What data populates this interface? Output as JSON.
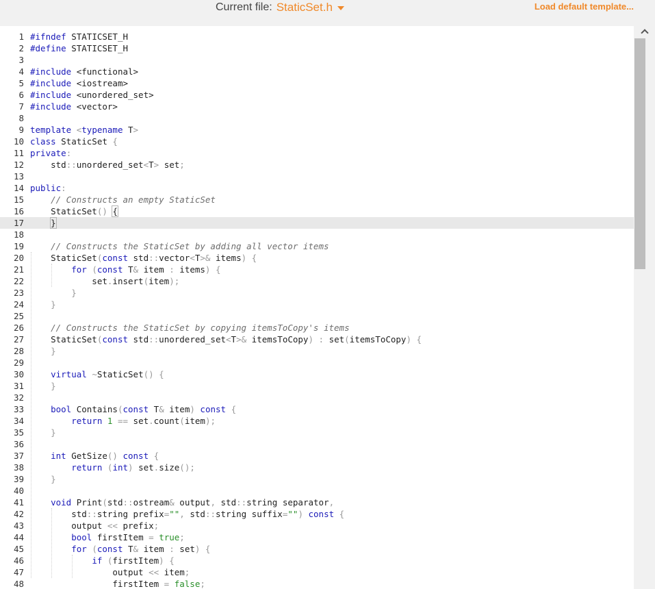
{
  "header": {
    "file_label": "Current file:",
    "file_name": "StaticSet.h",
    "load_template": "Load default template..."
  },
  "editor": {
    "active_line": 17,
    "lines": [
      {
        "n": "1",
        "tokens": [
          [
            "pp",
            "#ifndef "
          ],
          [
            "",
            "STATICSET_H"
          ]
        ]
      },
      {
        "n": "2",
        "tokens": [
          [
            "pp",
            "#define "
          ],
          [
            "",
            "STATICSET_H"
          ]
        ]
      },
      {
        "n": "3",
        "tokens": []
      },
      {
        "n": "4",
        "tokens": [
          [
            "pp",
            "#include "
          ],
          [
            "",
            "<functional>"
          ]
        ]
      },
      {
        "n": "5",
        "tokens": [
          [
            "pp",
            "#include "
          ],
          [
            "",
            "<iostream>"
          ]
        ]
      },
      {
        "n": "6",
        "tokens": [
          [
            "pp",
            "#include "
          ],
          [
            "",
            "<unordered_set>"
          ]
        ]
      },
      {
        "n": "7",
        "tokens": [
          [
            "pp",
            "#include "
          ],
          [
            "",
            "<vector>"
          ]
        ]
      },
      {
        "n": "8",
        "tokens": []
      },
      {
        "n": "9",
        "tokens": [
          [
            "kw",
            "template "
          ],
          [
            "pu",
            "<"
          ],
          [
            "kw",
            "typename "
          ],
          [
            "",
            "T"
          ],
          [
            "pu",
            ">"
          ]
        ]
      },
      {
        "n": "10",
        "tokens": [
          [
            "kw",
            "class "
          ],
          [
            "",
            "StaticSet "
          ],
          [
            "pu",
            "{"
          ]
        ]
      },
      {
        "n": "11",
        "tokens": [
          [
            "kw",
            "private"
          ],
          [
            "pu",
            ":"
          ]
        ]
      },
      {
        "n": "12",
        "tokens": [
          [
            "",
            "    std"
          ],
          [
            "pu",
            "::"
          ],
          [
            "",
            "unordered_set"
          ],
          [
            "pu",
            "<"
          ],
          [
            "",
            "T"
          ],
          [
            "pu",
            ">"
          ],
          [
            "",
            " set"
          ],
          [
            "pu",
            ";"
          ]
        ]
      },
      {
        "n": "13",
        "tokens": []
      },
      {
        "n": "14",
        "tokens": [
          [
            "kw",
            "public"
          ],
          [
            "pu",
            ":"
          ]
        ]
      },
      {
        "n": "15",
        "tokens": [
          [
            "",
            "    "
          ],
          [
            "cm",
            "// Constructs an empty StaticSet"
          ]
        ]
      },
      {
        "n": "16",
        "tokens": [
          [
            "",
            "    StaticSet"
          ],
          [
            "pu",
            "() "
          ],
          [
            "brk",
            "{"
          ]
        ]
      },
      {
        "n": "17",
        "tokens": [
          [
            "",
            "    "
          ],
          [
            "brk",
            "}"
          ],
          [
            "cursor",
            ""
          ]
        ]
      },
      {
        "n": "18",
        "tokens": []
      },
      {
        "n": "19",
        "tokens": [
          [
            "",
            "    "
          ],
          [
            "cm",
            "// Constructs the StaticSet by adding all vector items"
          ]
        ]
      },
      {
        "n": "20",
        "tokens": [
          [
            "",
            "    StaticSet"
          ],
          [
            "pu",
            "("
          ],
          [
            "kw",
            "const "
          ],
          [
            "",
            "std"
          ],
          [
            "pu",
            "::"
          ],
          [
            "",
            "vector"
          ],
          [
            "pu",
            "<"
          ],
          [
            "",
            "T"
          ],
          [
            "pu",
            ">&"
          ],
          [
            "",
            " items"
          ],
          [
            "pu",
            ") {"
          ]
        ]
      },
      {
        "n": "21",
        "tokens": [
          [
            "",
            "        "
          ],
          [
            "kw",
            "for "
          ],
          [
            "pu",
            "("
          ],
          [
            "kw",
            "const "
          ],
          [
            "",
            "T"
          ],
          [
            "pu",
            "&"
          ],
          [
            "",
            " item "
          ],
          [
            "pu",
            ":"
          ],
          [
            "",
            " items"
          ],
          [
            "pu",
            ") {"
          ]
        ]
      },
      {
        "n": "22",
        "tokens": [
          [
            "",
            "            set"
          ],
          [
            "pu",
            "."
          ],
          [
            "",
            "insert"
          ],
          [
            "pu",
            "("
          ],
          [
            "",
            "item"
          ],
          [
            "pu",
            ");"
          ]
        ]
      },
      {
        "n": "23",
        "tokens": [
          [
            "",
            "        "
          ],
          [
            "pu",
            "}"
          ]
        ]
      },
      {
        "n": "24",
        "tokens": [
          [
            "",
            "    "
          ],
          [
            "pu",
            "}"
          ]
        ]
      },
      {
        "n": "25",
        "tokens": []
      },
      {
        "n": "26",
        "tokens": [
          [
            "",
            "    "
          ],
          [
            "cm",
            "// Constructs the StaticSet by copying itemsToCopy's items"
          ]
        ]
      },
      {
        "n": "27",
        "tokens": [
          [
            "",
            "    StaticSet"
          ],
          [
            "pu",
            "("
          ],
          [
            "kw",
            "const "
          ],
          [
            "",
            "std"
          ],
          [
            "pu",
            "::"
          ],
          [
            "",
            "unordered_set"
          ],
          [
            "pu",
            "<"
          ],
          [
            "",
            "T"
          ],
          [
            "pu",
            ">&"
          ],
          [
            "",
            " itemsToCopy"
          ],
          [
            "pu",
            ") : "
          ],
          [
            "",
            "set"
          ],
          [
            "pu",
            "("
          ],
          [
            "",
            "itemsToCopy"
          ],
          [
            "pu",
            ") {"
          ]
        ]
      },
      {
        "n": "28",
        "tokens": [
          [
            "",
            "    "
          ],
          [
            "pu",
            "}"
          ]
        ]
      },
      {
        "n": "29",
        "tokens": []
      },
      {
        "n": "30",
        "tokens": [
          [
            "",
            "    "
          ],
          [
            "kw",
            "virtual "
          ],
          [
            "pu",
            "~"
          ],
          [
            "",
            "StaticSet"
          ],
          [
            "pu",
            "() {"
          ]
        ]
      },
      {
        "n": "31",
        "tokens": [
          [
            "",
            "    "
          ],
          [
            "pu",
            "}"
          ]
        ]
      },
      {
        "n": "32",
        "tokens": []
      },
      {
        "n": "33",
        "tokens": [
          [
            "",
            "    "
          ],
          [
            "kw",
            "bool "
          ],
          [
            "",
            "Contains"
          ],
          [
            "pu",
            "("
          ],
          [
            "kw",
            "const "
          ],
          [
            "",
            "T"
          ],
          [
            "pu",
            "&"
          ],
          [
            "",
            " item"
          ],
          [
            "pu",
            ") "
          ],
          [
            "kw",
            "const "
          ],
          [
            "pu",
            "{"
          ]
        ]
      },
      {
        "n": "34",
        "tokens": [
          [
            "",
            "        "
          ],
          [
            "kw",
            "return "
          ],
          [
            "nm",
            "1"
          ],
          [
            "pu",
            " == "
          ],
          [
            "",
            "set"
          ],
          [
            "pu",
            "."
          ],
          [
            "",
            "count"
          ],
          [
            "pu",
            "("
          ],
          [
            "",
            "item"
          ],
          [
            "pu",
            ");"
          ]
        ]
      },
      {
        "n": "35",
        "tokens": [
          [
            "",
            "    "
          ],
          [
            "pu",
            "}"
          ]
        ]
      },
      {
        "n": "36",
        "tokens": []
      },
      {
        "n": "37",
        "tokens": [
          [
            "",
            "    "
          ],
          [
            "kw",
            "int "
          ],
          [
            "",
            "GetSize"
          ],
          [
            "pu",
            "() "
          ],
          [
            "kw",
            "const "
          ],
          [
            "pu",
            "{"
          ]
        ]
      },
      {
        "n": "38",
        "tokens": [
          [
            "",
            "        "
          ],
          [
            "kw",
            "return "
          ],
          [
            "pu",
            "("
          ],
          [
            "kw",
            "int"
          ],
          [
            "pu",
            ") "
          ],
          [
            "",
            "set"
          ],
          [
            "pu",
            "."
          ],
          [
            "",
            "size"
          ],
          [
            "pu",
            "();"
          ]
        ]
      },
      {
        "n": "39",
        "tokens": [
          [
            "",
            "    "
          ],
          [
            "pu",
            "}"
          ]
        ]
      },
      {
        "n": "40",
        "tokens": []
      },
      {
        "n": "41",
        "tokens": [
          [
            "",
            "    "
          ],
          [
            "kw",
            "void "
          ],
          [
            "",
            "Print"
          ],
          [
            "pu",
            "("
          ],
          [
            "",
            "std"
          ],
          [
            "pu",
            "::"
          ],
          [
            "",
            "ostream"
          ],
          [
            "pu",
            "&"
          ],
          [
            "",
            " output"
          ],
          [
            "pu",
            ", "
          ],
          [
            "",
            "std"
          ],
          [
            "pu",
            "::"
          ],
          [
            "",
            "string separator"
          ],
          [
            "pu",
            ","
          ]
        ]
      },
      {
        "n": "42",
        "tokens": [
          [
            "",
            "        std"
          ],
          [
            "pu",
            "::"
          ],
          [
            "",
            "string prefix"
          ],
          [
            "pu",
            "="
          ],
          [
            "st",
            "\"\""
          ],
          [
            "pu",
            ", "
          ],
          [
            "",
            "std"
          ],
          [
            "pu",
            "::"
          ],
          [
            "",
            "string suffix"
          ],
          [
            "pu",
            "="
          ],
          [
            "st",
            "\"\""
          ],
          [
            "pu",
            ") "
          ],
          [
            "kw",
            "const "
          ],
          [
            "pu",
            "{"
          ]
        ]
      },
      {
        "n": "43",
        "tokens": [
          [
            "",
            "        output "
          ],
          [
            "pu",
            "<< "
          ],
          [
            "",
            "prefix"
          ],
          [
            "pu",
            ";"
          ]
        ]
      },
      {
        "n": "44",
        "tokens": [
          [
            "",
            "        "
          ],
          [
            "kw",
            "bool "
          ],
          [
            "",
            "firstItem "
          ],
          [
            "pu",
            "= "
          ],
          [
            "nm",
            "true"
          ],
          [
            "pu",
            ";"
          ]
        ]
      },
      {
        "n": "45",
        "tokens": [
          [
            "",
            "        "
          ],
          [
            "kw",
            "for "
          ],
          [
            "pu",
            "("
          ],
          [
            "kw",
            "const "
          ],
          [
            "",
            "T"
          ],
          [
            "pu",
            "&"
          ],
          [
            "",
            " item "
          ],
          [
            "pu",
            ":"
          ],
          [
            "",
            " set"
          ],
          [
            "pu",
            ") {"
          ]
        ]
      },
      {
        "n": "46",
        "tokens": [
          [
            "",
            "            "
          ],
          [
            "kw",
            "if "
          ],
          [
            "pu",
            "("
          ],
          [
            "",
            "firstItem"
          ],
          [
            "pu",
            ") {"
          ]
        ]
      },
      {
        "n": "47",
        "tokens": [
          [
            "",
            "                output "
          ],
          [
            "pu",
            "<< "
          ],
          [
            "",
            "item"
          ],
          [
            "pu",
            ";"
          ]
        ]
      },
      {
        "n": "48",
        "tokens": [
          [
            "",
            "                firstItem "
          ],
          [
            "pu",
            "= "
          ],
          [
            "nm",
            "false"
          ],
          [
            "pu",
            ";"
          ]
        ]
      }
    ]
  }
}
